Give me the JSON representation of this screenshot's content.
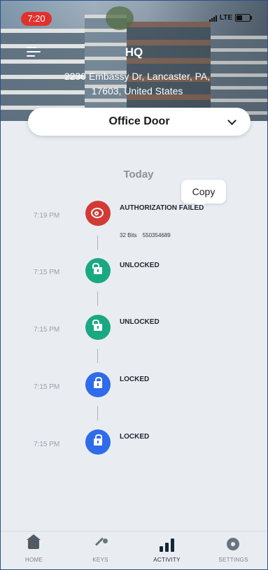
{
  "status_bar": {
    "time": "7:20",
    "network": "LTE"
  },
  "header": {
    "title": "HQ",
    "address_line1": "2230 Embassy Dr, Lancaster, PA,",
    "address_line2": "17603, United States"
  },
  "door_select": {
    "value": "Office Door"
  },
  "activity": {
    "day_label": "Today",
    "copy_tooltip": "Copy",
    "events": [
      {
        "time": "7:19 PM",
        "title": "AUTHORIZATION FAILED",
        "status": "failed",
        "color": "#d23a35",
        "detail_bits": "32 Bits",
        "detail_code": "550354689"
      },
      {
        "time": "7:15 PM",
        "title": "UNLOCKED",
        "status": "unlocked",
        "color": "#1aa883"
      },
      {
        "time": "7:15 PM",
        "title": "UNLOCKED",
        "status": "unlocked",
        "color": "#1aa883"
      },
      {
        "time": "7:15 PM",
        "title": "LOCKED",
        "status": "locked",
        "color": "#2f6bea"
      },
      {
        "time": "7:15 PM",
        "title": "LOCKED",
        "status": "locked",
        "color": "#2f6bea"
      }
    ]
  },
  "tabbar": {
    "tabs": [
      {
        "label": "HOME",
        "icon": "home-icon",
        "active": false
      },
      {
        "label": "KEYS",
        "icon": "key-icon",
        "active": false
      },
      {
        "label": "ACTIVITY",
        "icon": "bar-chart-icon",
        "active": true
      },
      {
        "label": "SETTINGS",
        "icon": "gear-icon",
        "active": false
      }
    ]
  }
}
